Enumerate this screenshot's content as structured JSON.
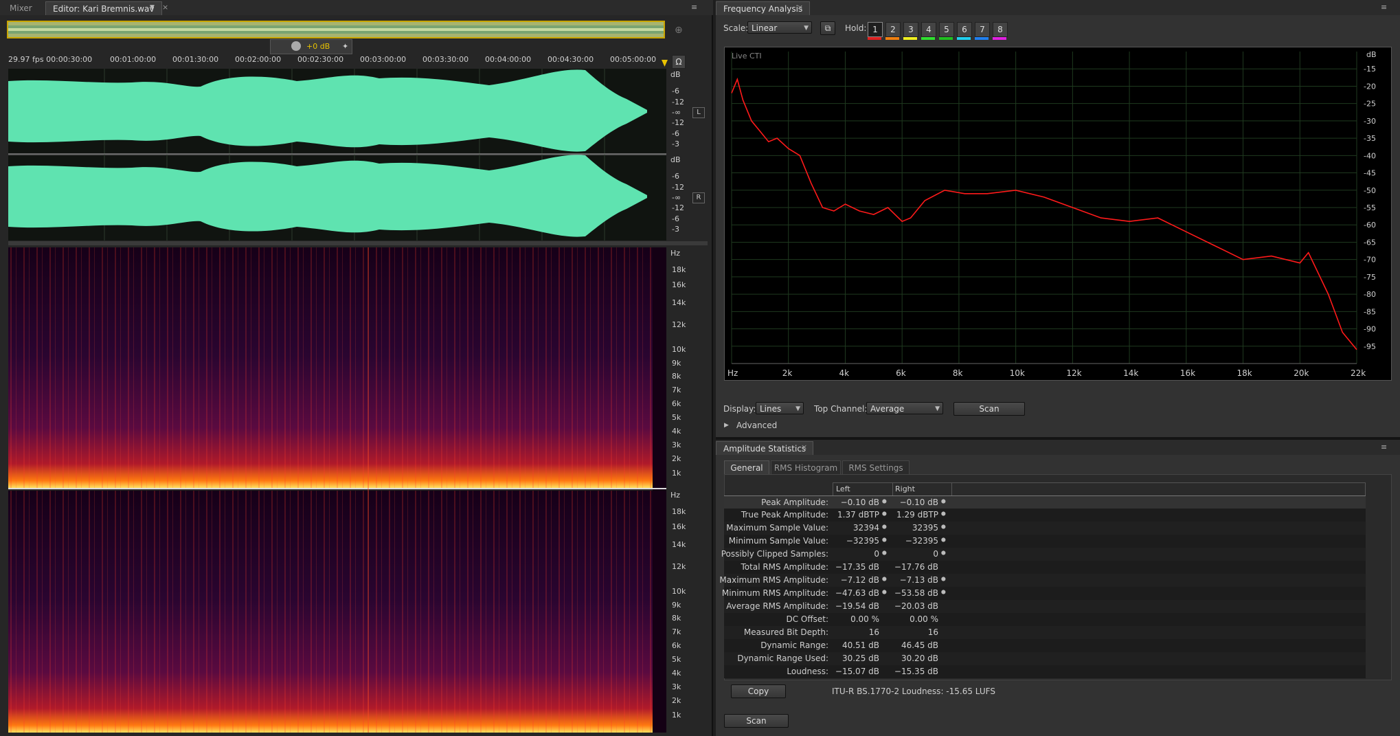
{
  "editor": {
    "tabs": [
      {
        "label": "Mixer"
      },
      {
        "label": "Editor: Kari Bremnis.wav"
      }
    ],
    "volume_readout": "+0 dB",
    "ruler": [
      "29.97 fps 00:00:30:00",
      "00:01:00:00",
      "00:01:30:00",
      "00:02:00:00",
      "00:02:30:00",
      "00:03:00:00",
      "00:03:30:00",
      "00:04:00:00",
      "00:04:30:00",
      "00:05:00:00"
    ],
    "db_scale_label": "dB",
    "db_ticks_top": [
      "-6",
      "-12",
      "-∞",
      "-12",
      "-6",
      "-3"
    ],
    "channel_left": "L",
    "channel_right": "R",
    "hz_label": "Hz",
    "hz_ticks": [
      "18k",
      "16k",
      "14k",
      "12k",
      "10k",
      "9k",
      "8k",
      "7k",
      "6k",
      "5k",
      "4k",
      "3k",
      "2k",
      "1k"
    ],
    "colors": {
      "waveform": "#5fe3b0",
      "spectro_bg": "#140014"
    }
  },
  "freq": {
    "title": "Frequency Analysis",
    "scale_label": "Scale:",
    "scale_value": "Linear",
    "hold_label": "Hold:",
    "holds": [
      "1",
      "2",
      "3",
      "4",
      "5",
      "6",
      "7",
      "8"
    ],
    "hold_colors": [
      "#e02020",
      "#f08010",
      "#f0f020",
      "#30e030",
      "#20c020",
      "#20d0f0",
      "#2080f0",
      "#e020e0"
    ],
    "live": "Live CTI",
    "x_ticks": [
      "Hz",
      "2k",
      "4k",
      "6k",
      "8k",
      "10k",
      "12k",
      "14k",
      "16k",
      "18k",
      "20k",
      "22k"
    ],
    "y_unit": "dB",
    "y_ticks": [
      "-15",
      "-20",
      "-25",
      "-30",
      "-35",
      "-40",
      "-45",
      "-50",
      "-55",
      "-60",
      "-65",
      "-70",
      "-75",
      "-80",
      "-85",
      "-90",
      "-95"
    ],
    "display_label": "Display:",
    "display_value": "Lines",
    "top_channel_label": "Top Channel:",
    "top_channel_value": "Average",
    "scan": "Scan",
    "advanced": "Advanced",
    "curve_color": "#ff1a1a"
  },
  "stats": {
    "title": "Amplitude Statistics",
    "tabs": [
      "General",
      "RMS Histogram",
      "RMS Settings"
    ],
    "col_left": "Left",
    "col_right": "Right",
    "rows": [
      {
        "label": "Peak Amplitude:",
        "left": "−0.10 dB",
        "right": "−0.10 dB"
      },
      {
        "label": "True Peak Amplitude:",
        "left": "1.37 dBTP",
        "right": "1.29 dBTP"
      },
      {
        "label": "Maximum Sample Value:",
        "left": "32394",
        "right": "32395"
      },
      {
        "label": "Minimum Sample Value:",
        "left": "−32395",
        "right": "−32395"
      },
      {
        "label": "Possibly Clipped Samples:",
        "left": "0",
        "right": "0"
      },
      {
        "label": "Total RMS Amplitude:",
        "left": "−17.35 dB",
        "right": "−17.76 dB"
      },
      {
        "label": "Maximum RMS Amplitude:",
        "left": "−7.12 dB",
        "right": "−7.13 dB"
      },
      {
        "label": "Minimum RMS Amplitude:",
        "left": "−47.63 dB",
        "right": "−53.58 dB"
      },
      {
        "label": "Average RMS Amplitude:",
        "left": "−19.54 dB",
        "right": "−20.03 dB"
      },
      {
        "label": "DC Offset:",
        "left": "0.00 %",
        "right": "0.00 %"
      },
      {
        "label": "Measured Bit Depth:",
        "left": "16",
        "right": "16"
      },
      {
        "label": "Dynamic Range:",
        "left": "40.51 dB",
        "right": "46.45 dB"
      },
      {
        "label": "Dynamic Range Used:",
        "left": "30.25 dB",
        "right": "30.20 dB"
      },
      {
        "label": "Loudness:",
        "left": "−15.07 dB",
        "right": "−15.35 dB"
      }
    ],
    "copy": "Copy",
    "loudness_line": "ITU-R BS.1770-2 Loudness: -15.65 LUFS",
    "scan": "Scan"
  },
  "chart_data": {
    "type": "line",
    "xlabel": "Hz",
    "ylabel": "dB",
    "xlim": [
      0,
      22000
    ],
    "ylim": [
      -100,
      -10
    ],
    "series": [
      {
        "x": [
          0,
          200,
          400,
          700,
          1000,
          1300,
          1600,
          2000,
          2400,
          2800,
          3200,
          3600,
          4000,
          4500,
          5000,
          5500,
          6000,
          6300,
          6800,
          7500,
          8200,
          9000,
          10000,
          11000,
          12000,
          13000,
          14000,
          15000,
          16000,
          17000,
          18000,
          19000,
          20000,
          20300,
          21000,
          21500,
          22000
        ],
        "values": [
          -22,
          -18,
          -24,
          -30,
          -33,
          -36,
          -35,
          -38,
          -40,
          -48,
          -55,
          -56,
          -54,
          -56,
          -57,
          -55,
          -59,
          -58,
          -53,
          -50,
          -51,
          -51,
          -50,
          -52,
          -55,
          -58,
          -59,
          -58,
          -62,
          -66,
          -70,
          -69,
          -71,
          -68,
          -80,
          -91,
          -96
        ]
      }
    ]
  }
}
